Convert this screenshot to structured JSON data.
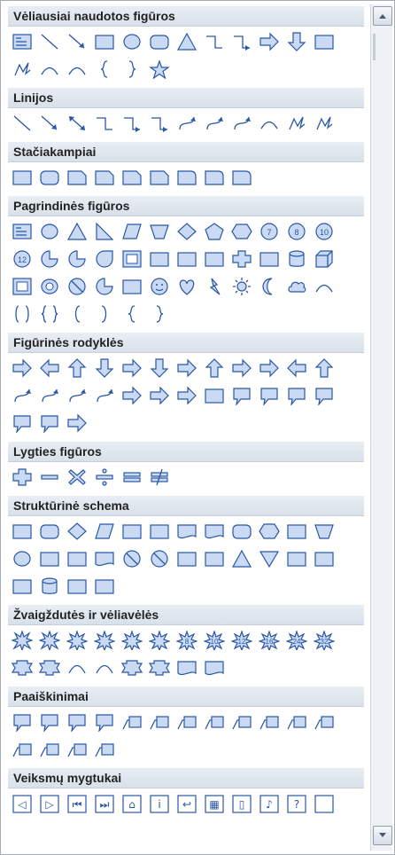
{
  "sections": [
    {
      "title": "Vėliausiai naudotos figūros",
      "icons": [
        "textbox",
        "line",
        "arrow-line",
        "rectangle",
        "oval",
        "rounded-rectangle",
        "triangle",
        "elbow-connector",
        "elbow-arrow-connector",
        "block-arrow-right",
        "block-arrow-down",
        "flowchart-shape",
        "freeform",
        "arc",
        "curve",
        "left-brace",
        "right-brace",
        "star"
      ]
    },
    {
      "title": "Linijos",
      "icons": [
        "line",
        "arrow-line",
        "double-arrow-line",
        "elbow-connector",
        "elbow-arrow-connector",
        "elbow-double-arrow",
        "curved-connector",
        "curved-arrow-connector",
        "curved-double-arrow",
        "curve",
        "freeform",
        "scribble"
      ]
    },
    {
      "title": "Stačiakampiai",
      "icons": [
        "rectangle",
        "rounded-rectangle",
        "snip-single-corner",
        "snip-same-side",
        "snip-diagonal",
        "snip-round",
        "round-single-corner",
        "round-same-side",
        "round-diagonal"
      ]
    },
    {
      "title": "Pagrindinės figūros",
      "icons": [
        "textbox",
        "oval",
        "triangle",
        "right-triangle",
        "parallelogram",
        "trapezoid",
        "diamond",
        "pentagon",
        "hexagon",
        "heptagon",
        "octagon",
        "decagon",
        "dodecagon",
        "pie",
        "chord",
        "teardrop",
        "frame",
        "half-frame",
        "l-shape",
        "diagonal-stripe",
        "cross",
        "plaque",
        "can",
        "cube",
        "bevel",
        "donut",
        "no-symbol",
        "block-arc",
        "folded-corner",
        "smiley-face",
        "heart",
        "lightning-bolt",
        "sun",
        "moon",
        "cloud",
        "arc",
        "double-bracket",
        "double-brace",
        "left-bracket",
        "right-bracket",
        "left-brace",
        "right-brace"
      ]
    },
    {
      "title": "Figūrinės rodyklės",
      "icons": [
        "block-arrow-right",
        "block-arrow-left",
        "block-arrow-up",
        "block-arrow-down",
        "left-right-arrow",
        "up-down-arrow",
        "quad-arrow",
        "left-right-up-arrow",
        "bent-arrow",
        "u-turn-arrow",
        "left-up-arrow",
        "bent-up-arrow",
        "curved-right-arrow",
        "curved-left-arrow",
        "curved-up-arrow",
        "curved-down-arrow",
        "striped-right-arrow",
        "notched-right-arrow",
        "pentagon-arrow",
        "chevron",
        "right-arrow-callout",
        "down-arrow-callout",
        "left-arrow-callout",
        "up-arrow-callout",
        "left-right-arrow-callout",
        "quad-arrow-callout",
        "circular-arrow"
      ]
    },
    {
      "title": "Lygties figūros",
      "icons": [
        "plus",
        "minus",
        "multiply",
        "divide",
        "equal",
        "not-equal"
      ]
    },
    {
      "title": "Struktūrinė schema",
      "icons": [
        "process",
        "alternate-process",
        "decision",
        "data",
        "predefined-process",
        "internal-storage",
        "document",
        "multidocument",
        "terminator",
        "preparation",
        "manual-input",
        "manual-operation",
        "connector",
        "off-page-connector",
        "card",
        "punched-tape",
        "summing-junction",
        "or",
        "collate",
        "sort",
        "extract",
        "merge",
        "stored-data",
        "delay",
        "sequential-access-storage",
        "magnetic-disk",
        "direct-access-storage",
        "display"
      ]
    },
    {
      "title": "Žvaigždutės ir vėliavėlės",
      "icons": [
        "explosion-1",
        "explosion-2",
        "star-4",
        "star-5",
        "star-6",
        "star-7",
        "star-8",
        "star-10",
        "star-12",
        "star-16",
        "star-24",
        "star-32",
        "up-ribbon",
        "down-ribbon",
        "curved-up-ribbon",
        "curved-down-ribbon",
        "vertical-scroll",
        "horizontal-scroll",
        "wave",
        "double-wave"
      ]
    },
    {
      "title": "Paaiškinimai",
      "icons": [
        "rectangular-callout",
        "rounded-rectangular-callout",
        "oval-callout",
        "cloud-callout",
        "line-callout-1",
        "line-callout-2",
        "line-callout-3",
        "line-callout-1-accent",
        "line-callout-2-accent",
        "line-callout-3-accent",
        "line-callout-1-no-border",
        "line-callout-2-no-border",
        "line-callout-3-no-border",
        "line-callout-1-border-accent",
        "line-callout-2-border-accent",
        "line-callout-3-border-accent"
      ]
    },
    {
      "title": "Veiksmų mygtukai",
      "icons": [
        "action-back",
        "action-forward",
        "action-beginning",
        "action-end",
        "action-home",
        "action-information",
        "action-return",
        "action-movie",
        "action-document",
        "action-sound",
        "action-help",
        "action-custom"
      ]
    }
  ],
  "colors": {
    "stroke": "#2b57a5",
    "fill": "#c9daf2",
    "header_bg": "#dde4ec",
    "border": "#a5acb5"
  },
  "scrollbar": {
    "up_icon": "scroll-up-icon",
    "down_icon": "scroll-down-icon"
  }
}
